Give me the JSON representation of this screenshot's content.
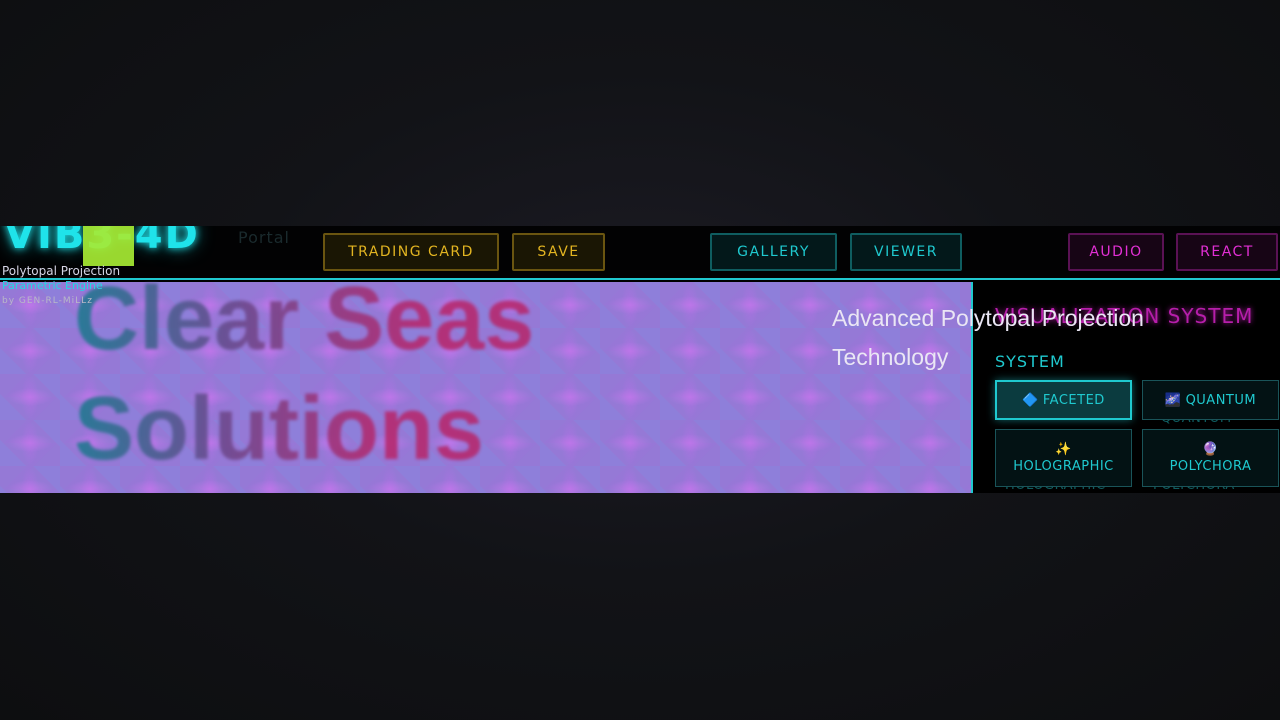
{
  "brand": {
    "logo_text": "VIB3-4D",
    "ghost_text": "Portal",
    "subtitle": "Polytopal Projection",
    "engine": "Parametric Engine",
    "byline": "by GEN-RL-MiLLz"
  },
  "toolbar": {
    "trading_card": "TRADING CARD",
    "save": "SAVE",
    "gallery": "GALLERY",
    "viewer": "VIEWER",
    "audio": "AUDIO",
    "react": "REACT"
  },
  "hero": {
    "line1": "Clear Seas",
    "line2": "Solutions",
    "tagline": "Advanced Polytopal Projection Technology"
  },
  "panel": {
    "title": "VISUALIZATION SYSTEM",
    "section_label": "SYSTEM",
    "systems": [
      {
        "label": "FACETED",
        "icon": "🔷"
      },
      {
        "label": "QUANTUM",
        "icon": "🌌"
      },
      {
        "label": "HOLOGRAPHIC",
        "icon": "✨"
      },
      {
        "label": "POLYCHORA",
        "icon": "🔮"
      }
    ]
  },
  "colors": {
    "accent_cyan": "#1fc9cf",
    "accent_magenta": "#e22fd4",
    "accent_gold": "#e2b421",
    "logo_lime": "#a6ea33",
    "canvas_purple": "#9579d6"
  }
}
